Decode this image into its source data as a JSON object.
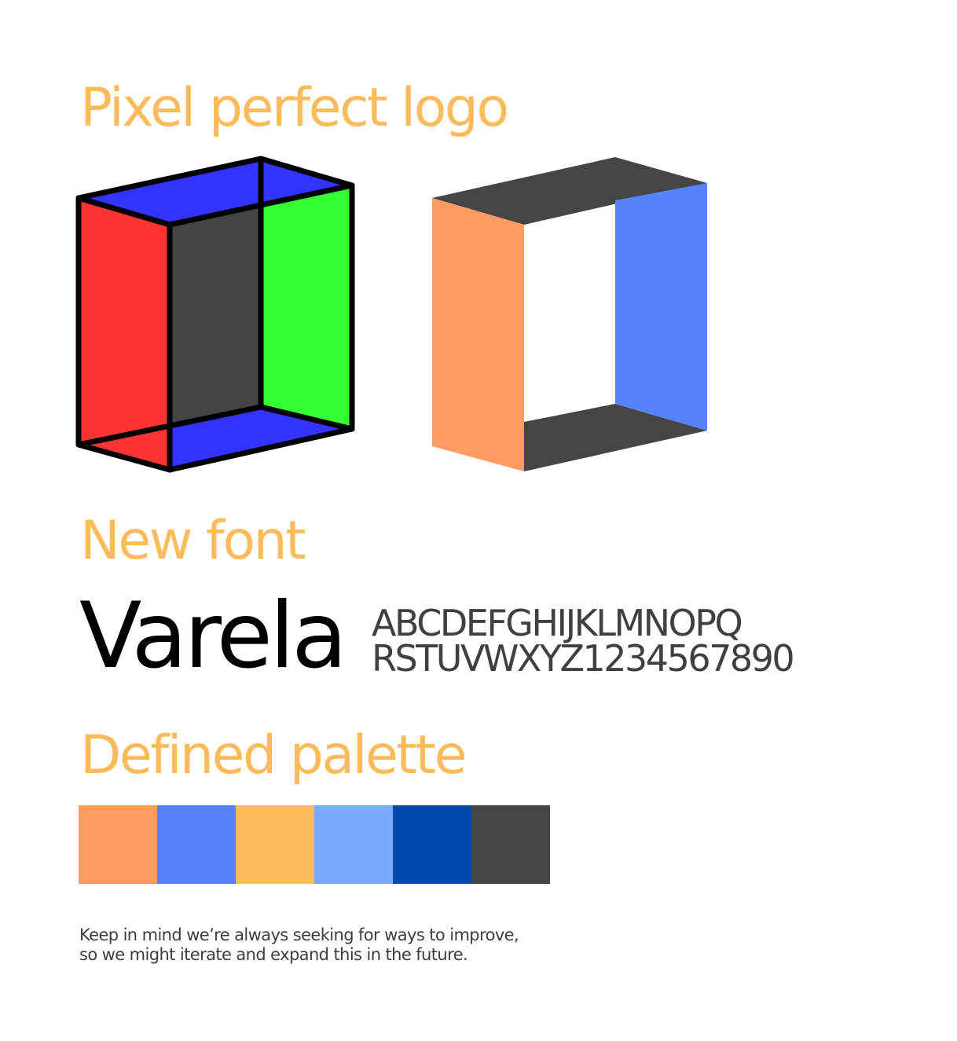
{
  "headings": {
    "logo": "Pixel perfect logo",
    "font": "New font",
    "palette": "Defined palette"
  },
  "colors": {
    "heading": "#FDBB5C",
    "body_text": "#000000",
    "sample_text": "#404040",
    "note_text": "#3d3d3d",
    "outline": "#000000",
    "wire_left": "#FF3333",
    "wire_back": "#444444",
    "wire_right": "#33FF33",
    "wire_top_bottom": "#3333FF",
    "solid_left": "#FC9C63",
    "solid_top_bottom": "#454545",
    "solid_right": "#5483FC"
  },
  "logos": [
    {
      "name": "wireframe-box-logo"
    },
    {
      "name": "solid-box-logo"
    }
  ],
  "font": {
    "name": "Varela",
    "sample_line_1": "ABCDEFGHIJKLMNOPQ",
    "sample_line_2": "RSTUVWXYZ1234567890"
  },
  "palette": [
    {
      "name": "orange",
      "color": "#FC9C63"
    },
    {
      "name": "blue",
      "color": "#5483FC"
    },
    {
      "name": "yellow",
      "color": "#FDBB5C"
    },
    {
      "name": "light-blue",
      "color": "#7AAAFC"
    },
    {
      "name": "dark-blue",
      "color": "#004AAD"
    },
    {
      "name": "dark-gray",
      "color": "#454545"
    }
  ],
  "note": {
    "line_1": "Keep in mind we’re always seeking for ways to improve,",
    "line_2": "so we might iterate and expand this in the future."
  }
}
